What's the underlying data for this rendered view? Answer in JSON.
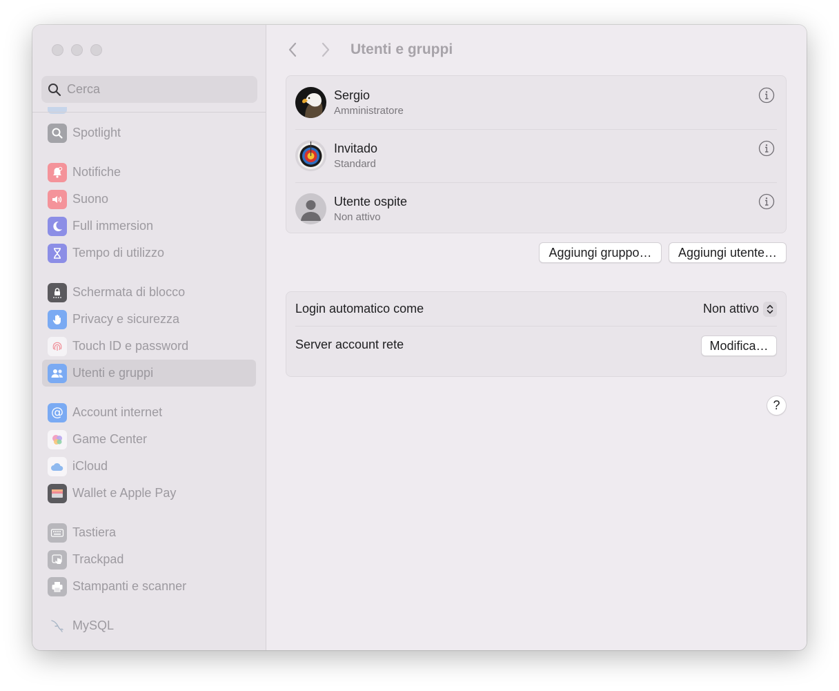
{
  "window": {
    "title": "Utenti e gruppi"
  },
  "search": {
    "placeholder": "Cerca"
  },
  "sidebar": {
    "items": [
      {
        "label": "Spotlight",
        "icon": "magnifier-icon",
        "color": "#8e8e93"
      },
      {
        "label": "Notifiche",
        "icon": "bell-icon",
        "color": "#f3747d"
      },
      {
        "label": "Suono",
        "icon": "speaker-icon",
        "color": "#f3747d"
      },
      {
        "label": "Full immersion",
        "icon": "moon-icon",
        "color": "#6f72df"
      },
      {
        "label": "Tempo di utilizzo",
        "icon": "hourglass-icon",
        "color": "#6f72df"
      },
      {
        "label": "Schermata di blocco",
        "icon": "lock-icon",
        "color": "#2c2c2e"
      },
      {
        "label": "Privacy e sicurezza",
        "icon": "hand-icon",
        "color": "#4f8ff0"
      },
      {
        "label": "Touch ID e password",
        "icon": "fingerprint-icon",
        "color": "#ffffff"
      },
      {
        "label": "Utenti e gruppi",
        "icon": "users-icon",
        "color": "#4f8ff0",
        "selected": true
      },
      {
        "label": "Account internet",
        "icon": "at-icon",
        "color": "#4f8ff0"
      },
      {
        "label": "Game Center",
        "icon": "game-center-icon",
        "color": "#ffffff"
      },
      {
        "label": "iCloud",
        "icon": "cloud-icon",
        "color": "#ffffff"
      },
      {
        "label": "Wallet e Apple Pay",
        "icon": "wallet-icon",
        "color": "#2c2c2e"
      },
      {
        "label": "Tastiera",
        "icon": "keyboard-icon",
        "color": "#8e8e93"
      },
      {
        "label": "Trackpad",
        "icon": "trackpad-icon",
        "color": "#8e8e93"
      },
      {
        "label": "Stampanti e scanner",
        "icon": "printer-icon",
        "color": "#8e8e93"
      },
      {
        "label": "MySQL",
        "icon": "dolphin-icon",
        "color": "#ffffff"
      }
    ]
  },
  "users": [
    {
      "name": "Sergio",
      "role": "Amministratore",
      "avatar": "eagle-avatar"
    },
    {
      "name": "Invitado",
      "role": "Standard",
      "avatar": "target-avatar"
    },
    {
      "name": "Utente ospite",
      "role": "Non attivo",
      "avatar": "person-avatar"
    }
  ],
  "actions": {
    "add_group": "Aggiungi gruppo…",
    "add_user": "Aggiungi utente…"
  },
  "settings": {
    "auto_login_label": "Login automatico come",
    "auto_login_value": "Non attivo",
    "network_server_label": "Server account rete",
    "edit_label": "Modifica…"
  },
  "help": {
    "label": "?"
  },
  "colors": {
    "accent": "#4f8ff0",
    "sidebar_bg": "#e8e4e9",
    "content_bg": "#efebf0"
  }
}
